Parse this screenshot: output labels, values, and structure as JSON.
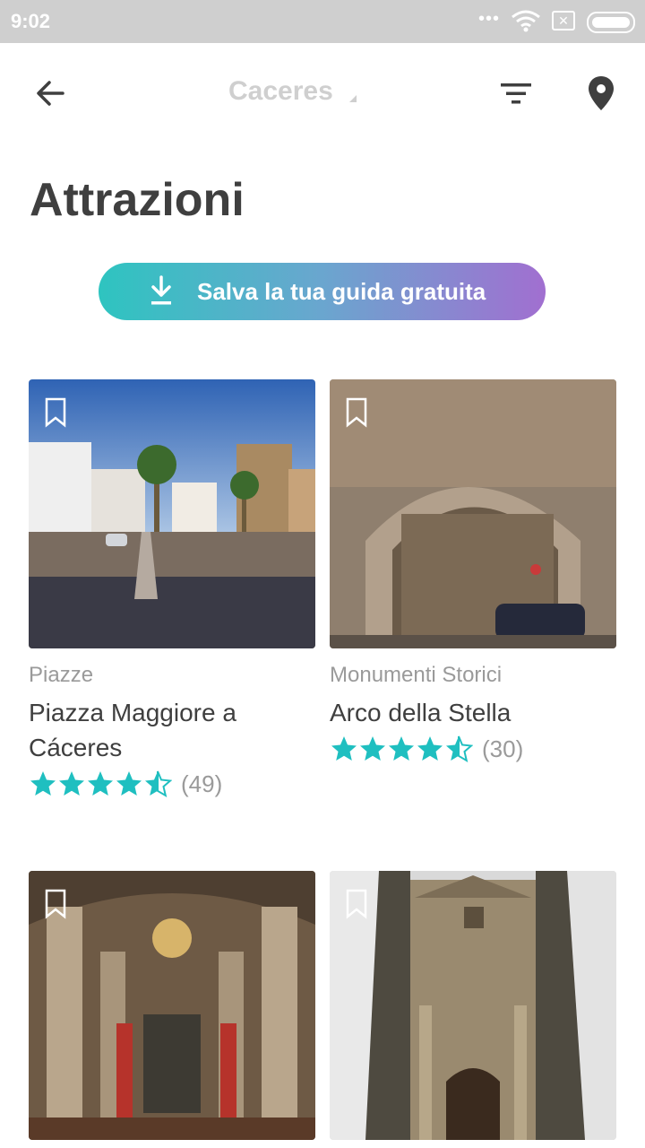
{
  "status_bar": {
    "time": "9:02",
    "dots": "•••"
  },
  "app_bar": {
    "title": "Caceres"
  },
  "page": {
    "heading": "Attrazioni"
  },
  "save_button": {
    "label": "Salva la tua guida gratuita"
  },
  "colors": {
    "accent": "#1fbfc0",
    "gradient_start": "#2ec4c0",
    "gradient_end": "#a16fd0",
    "muted": "#9a9a9a"
  },
  "cards": [
    {
      "category": "Piazze",
      "name": "Piazza Maggiore a Cáceres",
      "rating": 4.5,
      "count": "(49)"
    },
    {
      "category": "Monumenti Storici",
      "name": "Arco della Stella",
      "rating": 4.5,
      "count": "(30)"
    },
    {
      "category": "",
      "name": "",
      "rating": null,
      "count": ""
    },
    {
      "category": "",
      "name": "",
      "rating": null,
      "count": ""
    }
  ]
}
